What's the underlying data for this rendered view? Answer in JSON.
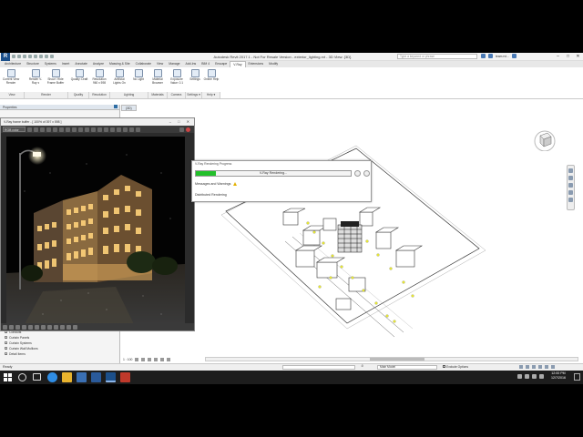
{
  "window": {
    "title": "Autodesk Revit 2017.1 - Not For Resale Version - exterior_lighting.rvt - 3D View: {3D}",
    "search_placeholder": "Type a keyword or phrase",
    "user": "team.rvt..."
  },
  "ribbon": {
    "tabs": [
      "Architecture",
      "Structure",
      "Systems",
      "Insert",
      "Annotate",
      "Analyze",
      "Massing & Site",
      "Collaborate",
      "View",
      "Manage",
      "Add-Ins",
      "BIM 4",
      "Enscape",
      "V-Ray",
      "Extensions",
      "Modify"
    ],
    "active_tab": "V-Ray",
    "buttons": [
      {
        "label": "Current View Render"
      },
      {
        "label": "Render V-Ray ▾"
      },
      {
        "label": "Show / Hide Frame Buffer"
      },
      {
        "label": "Quality: Draft"
      },
      {
        "label": "Resolution 960 x 598"
      },
      {
        "label": "Artificial Lights On"
      },
      {
        "label": "No Light"
      },
      {
        "label": "Material Browser"
      },
      {
        "label": "Exposure Value: 0.1"
      },
      {
        "label": "Settings"
      },
      {
        "label": "Online Help"
      }
    ],
    "groups": [
      "View",
      "Render",
      "Quality",
      "Resolution",
      "Lighting",
      "Materials",
      "Camera",
      "Settings ▾",
      "Help ▾"
    ]
  },
  "properties": {
    "title": "Properties"
  },
  "vfb": {
    "title": "V-Ray frame buffer - [ 100% of 397 x 598 ]",
    "channel": "RGB color"
  },
  "project_browser": {
    "items": [
      "Conduits",
      "Curtain Panels",
      "Curtain Systems",
      "Curtain Wall Mullions",
      "Detail Items"
    ]
  },
  "view": {
    "tab_label": "{3D}",
    "scale": "1 : 100"
  },
  "progress": {
    "title": "V-Ray Rendering Progress",
    "bar_label": "V-Ray Rendering...",
    "progress": 0.13,
    "messages": "Messages and Warnings",
    "distributed": "Distributed Rendering"
  },
  "status": {
    "ready": "Ready",
    "model": "Main Model",
    "zero": ":0",
    "exclude": "Exclude Options"
  },
  "taskbar": {
    "time": "12:00 PM",
    "date": "12/7/2016"
  },
  "colors": {
    "progress_green": "#22c02a",
    "revit_blue": "#1b4f8a",
    "lights_yellow": "#e6e633"
  }
}
